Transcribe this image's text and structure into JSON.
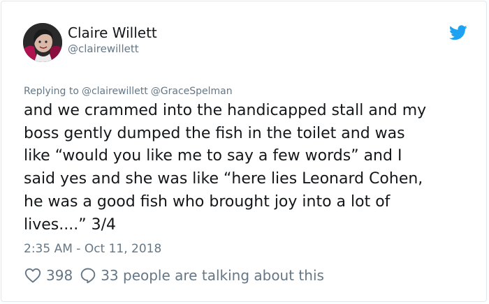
{
  "tweet": {
    "author": {
      "name": "Claire Willett",
      "handle": "@clairewillett"
    },
    "replying_to": {
      "label": "Replying to",
      "mentions": [
        "@clairewillett",
        "@GraceSpelman"
      ]
    },
    "text_lines": [
      "and we crammed into the handicapped stall and my",
      "boss gently dumped the fish in the toilet and was",
      "like “would you like me to say a few words” and I",
      "said yes and she was like “here lies Leonard Cohen,",
      "he was a good fish who brought joy into a lot of",
      "lives....” 3/4"
    ],
    "timestamp": "2:35 AM - Oct 11, 2018",
    "likes": "398",
    "conversation_text": "33 people are talking about this",
    "icons": {
      "brand": "twitter-bird-icon",
      "like": "heart-icon",
      "reply": "speech-bubble-icon"
    },
    "colors": {
      "brand_blue": "#1da1f2",
      "secondary_text": "#657786",
      "primary_text": "#14171a",
      "border": "#e1e8ed"
    }
  }
}
